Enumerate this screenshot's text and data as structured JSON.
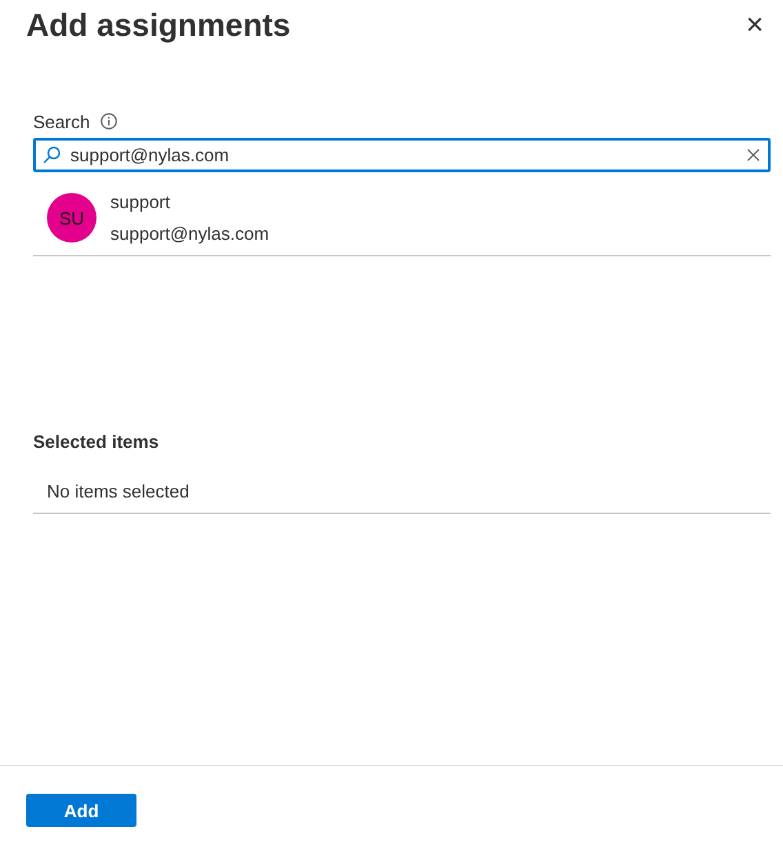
{
  "panel": {
    "title": "Add assignments",
    "close_label": "×"
  },
  "search": {
    "label": "Search",
    "value": "support@nylas.com"
  },
  "results": [
    {
      "initials": "SU",
      "color": "#e3008c",
      "name": "support",
      "email": "support@nylas.com"
    }
  ],
  "selected_items": {
    "heading": "Selected items",
    "empty_text": "No items selected"
  },
  "buttons": [
    {
      "label": "Add"
    }
  ]
}
